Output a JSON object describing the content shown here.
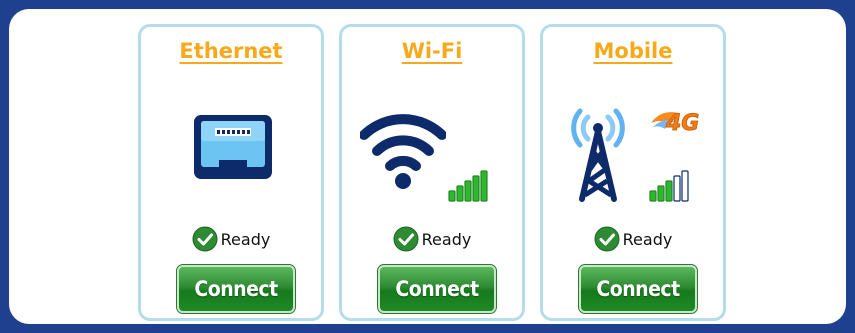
{
  "cards": [
    {
      "title": "Ethernet",
      "status": "Ready",
      "button_label": "Connect",
      "icon": "ethernet-port-icon"
    },
    {
      "title": "Wi-Fi",
      "status": "Ready",
      "button_label": "Connect",
      "icon": "wifi-icon",
      "signal_bars_filled": 5,
      "signal_bars_total": 5
    },
    {
      "title": "Mobile",
      "status": "Ready",
      "button_label": "Connect",
      "icon": "cell-tower-icon",
      "badge_icon": "4g-icon",
      "badge_text": "4G",
      "signal_bars_filled": 3,
      "signal_bars_total": 5
    }
  ],
  "colors": {
    "title": "#f7a81b",
    "card_border": "#b5dcea",
    "button": "#2e8b34",
    "frame": "#1f3f8f",
    "icon_navy": "#0d2a6b",
    "signal_green": "#2fb52f",
    "ready_green": "#2e8b34"
  }
}
